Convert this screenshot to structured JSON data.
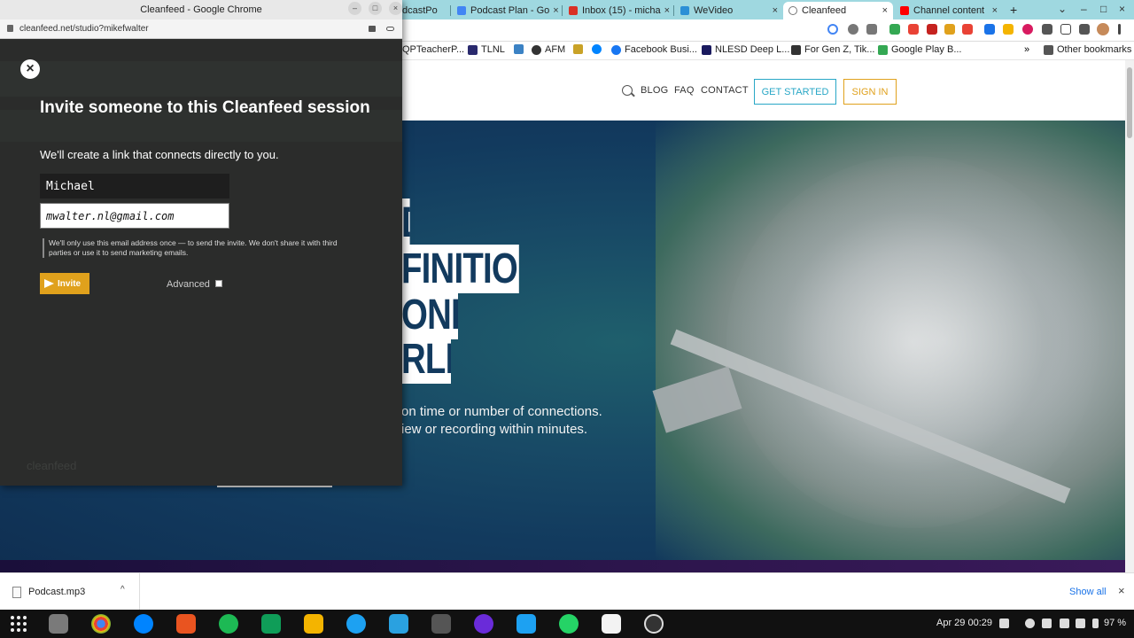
{
  "main_window": {
    "tabs": [
      {
        "label": "dcastPo",
        "close": "×",
        "color": "#f4b400"
      },
      {
        "label": "Podcast Plan - Go",
        "close": "×",
        "color": "#4285f4"
      },
      {
        "label": "Inbox (15) - micha",
        "close": "×",
        "color": "#d93025"
      },
      {
        "label": "WeVideo",
        "close": "×",
        "color": "#2c8fd6"
      },
      {
        "label": "Cleanfeed",
        "close": "×",
        "color": "#777777"
      },
      {
        "label": "Channel content",
        "close": "×",
        "color": "#ff0000"
      }
    ],
    "new_tab": "+",
    "window_controls": {
      "dropdown": "⌄",
      "minimize": "–",
      "maximize": "□",
      "close": "×"
    },
    "bookmarks": [
      {
        "label": "QPTeacherP...",
        "color": "#e6a23c"
      },
      {
        "label": "TLNL",
        "color": "#2a2a6e"
      },
      {
        "label": "AFM",
        "color": "#333333"
      },
      {
        "label": "",
        "color": "#c9a227"
      },
      {
        "label": "",
        "color": "#0084ff"
      },
      {
        "label": "Facebook Busi...",
        "color": "#1877f2"
      },
      {
        "label": "NLESD Deep L...",
        "color": "#1a1a5e"
      },
      {
        "label": "For Gen Z, Tik...",
        "color": "#333333"
      },
      {
        "label": "Google Play B...",
        "color": "#34a853"
      }
    ],
    "bookmarks_more": "»",
    "other_bookmarks": "Other bookmarks"
  },
  "site": {
    "nav": {
      "blog": "BLOG",
      "faq": "FAQ",
      "contact": "CONTACT",
      "get_started": "GET STARTED",
      "sign_in": "SIGN IN",
      "get_started_color": "#29a7c6",
      "sign_in_color": "#e0a11c"
    },
    "hero_lines": [
      "D",
      "FINITION",
      "ONE",
      "RLD"
    ],
    "hero_sub_1": "on time or number of connections.",
    "hero_sub_2": "iew or recording within minutes."
  },
  "download_bar": {
    "file_name": "Podcast.mp3",
    "chevron": "^",
    "show_all": "Show all",
    "close": "×"
  },
  "taskbar": {
    "date_time": "Apr 29  00:29",
    "battery": "97 %"
  },
  "popup": {
    "window_title": "Cleanfeed - Google Chrome",
    "url": "cleanfeed.net/studio?mikefwalter",
    "ghost_text": "cleanfeed",
    "dialog": {
      "close_symbol": "×",
      "title": "Invite someone to this Cleanfeed session",
      "subtitle": "We'll create a link that connects directly to you.",
      "name_value": "Michael",
      "email_value": "mwalter.nl@gmail.com",
      "note": "We'll only use this email address once — to send the invite. We don't share it with third parties or use it to send marketing emails.",
      "invite_label": "Invite",
      "advanced_label": "Advanced",
      "accent_color": "#e0a11c"
    }
  }
}
